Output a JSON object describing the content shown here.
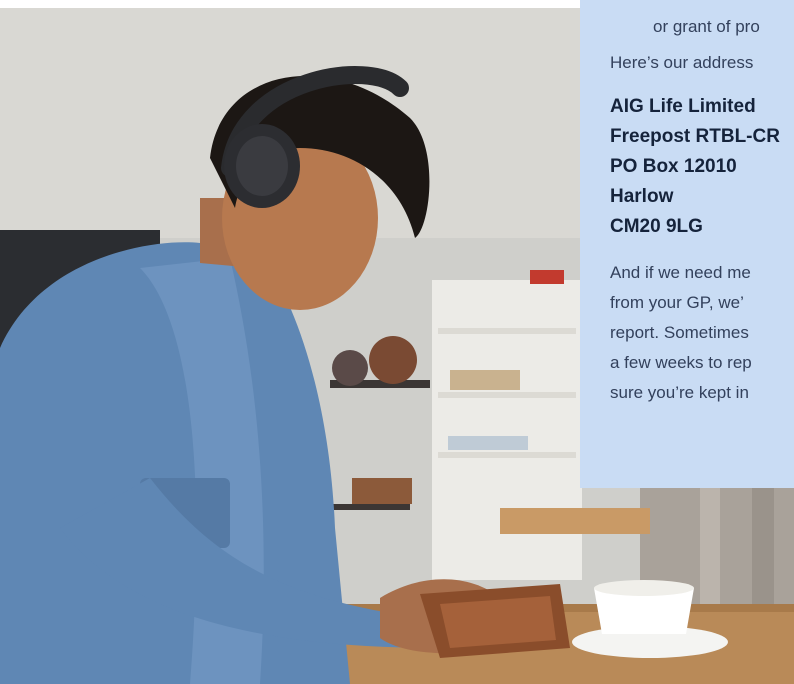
{
  "card": {
    "fragment_top": "or grant of pro",
    "address_intro": "Here’s our address",
    "address_lines": [
      "AIG Life Limited",
      "Freepost RTBL-CR",
      "PO Box 12010",
      "Harlow",
      "CM20 9LG"
    ],
    "paragraph_lines": [
      "And if we need me",
      "from your GP, we’",
      "report. Sometimes",
      "a few weeks to rep",
      "sure you’re kept in"
    ]
  },
  "photo": {
    "subject": "man-with-headphones-reading"
  },
  "colors": {
    "card_bg": "#c9dcf4",
    "text_dark": "#15233b",
    "shirt": "#5f87b4"
  }
}
